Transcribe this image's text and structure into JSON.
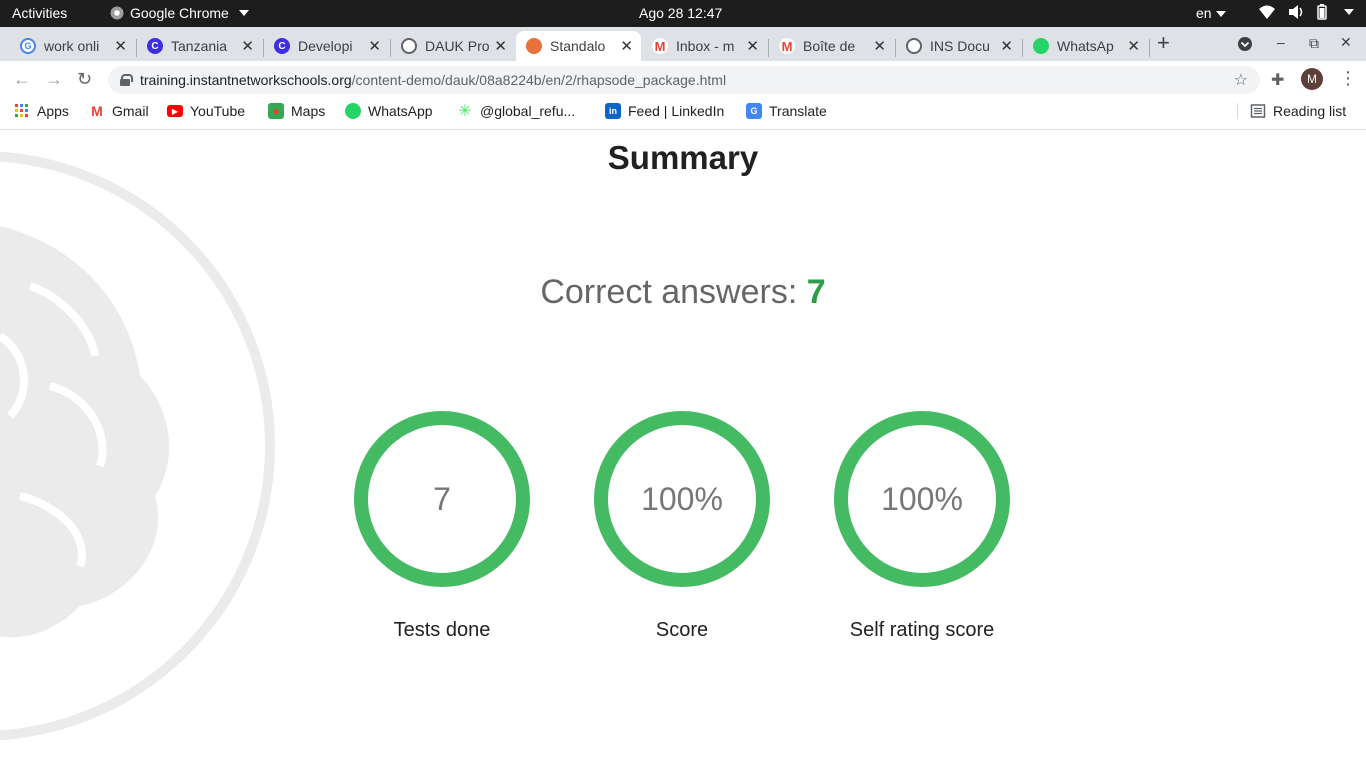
{
  "system": {
    "activities": "Activities",
    "app_name": "Google Chrome",
    "clock": "Ago 28  12:47",
    "language": "en"
  },
  "tabs": [
    {
      "title": "work onli",
      "favicon": "google-icon",
      "color": "#4285f4"
    },
    {
      "title": "Tanzania",
      "favicon": "c-icon",
      "color": "#3d2fe0"
    },
    {
      "title": "Developi",
      "favicon": "c-icon",
      "color": "#3d2fe0"
    },
    {
      "title": "DAUK Pro",
      "favicon": "globe-icon",
      "color": "#5f6368"
    },
    {
      "title": "Standalo",
      "favicon": "brain-icon",
      "color": "#e8703a",
      "active": true
    },
    {
      "title": "Inbox - m",
      "favicon": "gmail-icon",
      "color": "#ea4335"
    },
    {
      "title": "Boîte de",
      "favicon": "gmail-icon",
      "color": "#ea4335"
    },
    {
      "title": "INS Docu",
      "favicon": "globe-icon",
      "color": "#5f6368"
    },
    {
      "title": "WhatsAp",
      "favicon": "whatsapp-icon",
      "color": "#25d366"
    }
  ],
  "address": {
    "host": "training.instantnetworkschools.org",
    "path": "/content-demo/dauk/08a8224b/en/2/rhapsode_package.html"
  },
  "profile_initial": "M",
  "bookmarks": [
    {
      "label": "Apps",
      "icon": "apps-grid-icon"
    },
    {
      "label": "Gmail",
      "icon": "gmail-icon"
    },
    {
      "label": "YouTube",
      "icon": "youtube-icon"
    },
    {
      "label": "Maps",
      "icon": "maps-icon"
    },
    {
      "label": "WhatsApp",
      "icon": "whatsapp-icon"
    },
    {
      "label": "@global_refu...",
      "icon": "linktree-icon"
    },
    {
      "label": "Feed | LinkedIn",
      "icon": "linkedin-icon"
    },
    {
      "label": "Translate",
      "icon": "translate-icon"
    }
  ],
  "reading_list": "Reading list",
  "summary": {
    "title": "Summary",
    "correct_label": "Correct answers:",
    "correct_value": "7",
    "stats": [
      {
        "value": "7",
        "label": "Tests done"
      },
      {
        "value": "100%",
        "label": "Score"
      },
      {
        "value": "100%",
        "label": "Self rating score"
      }
    ]
  },
  "colors": {
    "accent_green": "#44ba63",
    "correct_green": "#2e9e46"
  }
}
